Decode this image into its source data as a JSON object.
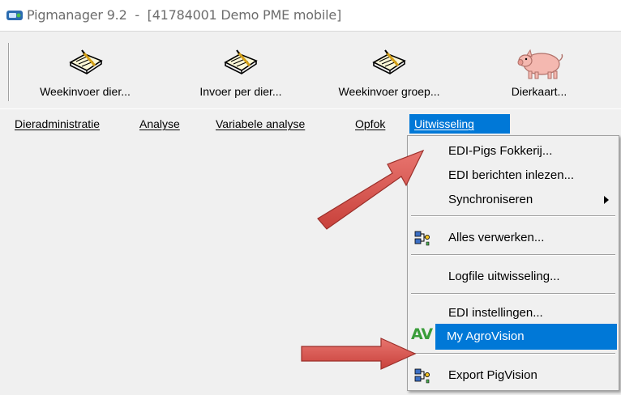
{
  "window": {
    "title": "Pigmanager 9.2  -  [41784001 Demo PME mobile]",
    "icon": "app-icon"
  },
  "toolbar": {
    "buttons": [
      {
        "label": "Weekinvoer dier...",
        "icon": "book-pen-icon"
      },
      {
        "label": "Invoer per dier...",
        "icon": "book-pen-icon"
      },
      {
        "label": "Weekinvoer groep...",
        "icon": "book-pen-icon"
      },
      {
        "label": "Dierkaart...",
        "icon": "pig-icon"
      }
    ]
  },
  "menubar": {
    "items": [
      {
        "label": "Dieradministratie"
      },
      {
        "label": "Analyse"
      },
      {
        "label": "Variabele analyse"
      },
      {
        "label": "Opfok"
      },
      {
        "label": "Uitwisseling",
        "active": true
      }
    ]
  },
  "dropdown": {
    "items": [
      {
        "label": "EDI-Pigs Fokkerij..."
      },
      {
        "label": "EDI berichten inlezen..."
      },
      {
        "label": "Synchroniseren",
        "submenu": true
      },
      {
        "label": "Alles verwerken...",
        "icon": "network-icon"
      },
      {
        "label": "Logfile uitwisseling..."
      },
      {
        "label": "EDI instellingen..."
      },
      {
        "label": "My AgroVision",
        "icon": "agrovision-logo-icon",
        "highlighted": true,
        "logo_text": "AV"
      },
      {
        "label": "Export PigVision",
        "icon": "network-icon"
      }
    ]
  },
  "colors": {
    "highlight": "#0078d7",
    "menu_background": "#f0f0f0",
    "annotation_arrow": "#d9534f"
  }
}
